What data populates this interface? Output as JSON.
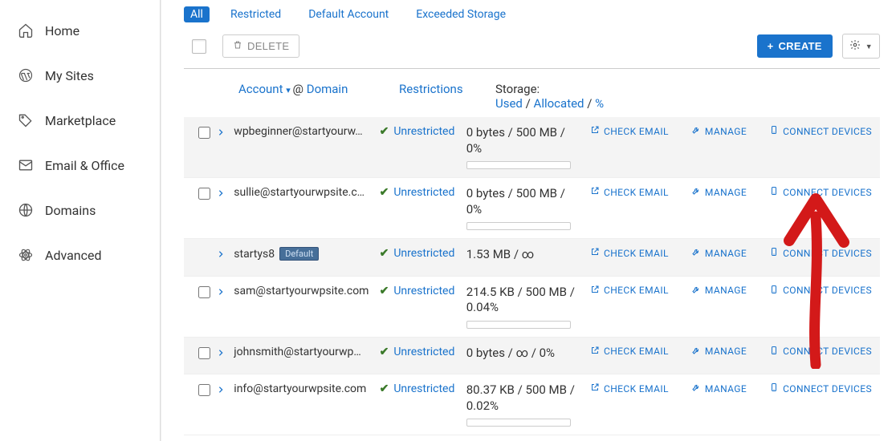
{
  "sidebar": {
    "items": [
      {
        "label": "Home",
        "icon": "home-icon"
      },
      {
        "label": "My Sites",
        "icon": "wordpress-icon"
      },
      {
        "label": "Marketplace",
        "icon": "tag-icon"
      },
      {
        "label": "Email & Office",
        "icon": "mail-icon"
      },
      {
        "label": "Domains",
        "icon": "globe-icon"
      },
      {
        "label": "Advanced",
        "icon": "atom-icon"
      }
    ]
  },
  "filters": {
    "all": "All",
    "restricted": "Restricted",
    "default_account": "Default Account",
    "exceeded_storage": "Exceeded Storage"
  },
  "toolbar": {
    "delete": "DELETE",
    "create": "CREATE"
  },
  "headers": {
    "account": "Account",
    "at": "@",
    "domain": "Domain",
    "restrictions": "Restrictions",
    "storage_label": "Storage:",
    "used": "Used",
    "allocated": "Allocated",
    "percent": "%"
  },
  "action_labels": {
    "check_email": "CHECK EMAIL",
    "manage": "MANAGE",
    "connect_devices": "CONNECT DEVICES"
  },
  "restriction_label": "Unrestricted",
  "default_badge": "Default",
  "rows": [
    {
      "account": "wpbeginner@startyourw…",
      "storage": "0 bytes / 500 MB / 0%",
      "bar": true,
      "has_checkbox": true,
      "default": false
    },
    {
      "account": "sullie@startyourwpsite.c…",
      "storage": "0 bytes / 500 MB / 0%",
      "bar": true,
      "has_checkbox": true,
      "default": false
    },
    {
      "account": "startys8",
      "storage": "1.53 MB / ∞",
      "bar": false,
      "has_checkbox": false,
      "default": true
    },
    {
      "account": "sam@startyourwpsite.com",
      "storage": "214.5 KB / 500 MB / 0.04%",
      "bar": true,
      "has_checkbox": true,
      "default": false
    },
    {
      "account": "johnsmith@startyourwp…",
      "storage": "0 bytes / ∞ / 0%",
      "bar": false,
      "has_checkbox": true,
      "default": false
    },
    {
      "account": "info@startyourwpsite.com",
      "storage": "80.37 KB / 500 MB / 0.02%",
      "bar": true,
      "has_checkbox": true,
      "default": false
    }
  ]
}
